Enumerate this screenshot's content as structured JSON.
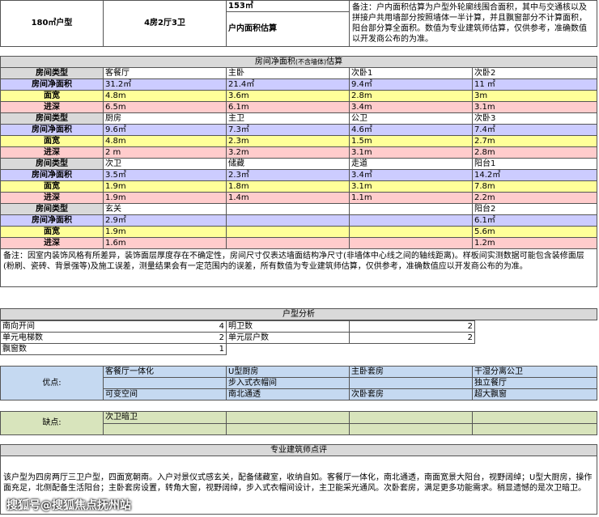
{
  "header": {
    "type": "180㎡户型",
    "layout": "4房2厅3卫",
    "area_value": "153㎡",
    "area_label": "户内面积估算",
    "note": "备注：户内面积估算为户型外轮廓线围合面积，其中与交通核以及拼接户共用墙部分按照墙体一半计算，并且飘窗部分不计算面积，阳台部分算全面积。数值为专业建筑师估算，仅供参考，准确数值以开发商公布的为准。"
  },
  "room_table": {
    "title": "房间净面积",
    "title_small": "(不含墙体)",
    "title_tail": "估算",
    "labels": [
      "房间类型",
      "房间净面积",
      "面宽",
      "进深"
    ],
    "groups": [
      [
        [
          "客餐厅",
          "31.2㎡",
          "4.8m",
          "6.5m"
        ],
        [
          "主卧",
          "21.4㎡",
          "3.6m",
          "6.1m"
        ],
        [
          "次卧1",
          "9.4㎡",
          "2.8m",
          "3.4m"
        ],
        [
          "次卧2",
          "11 ㎡",
          "3m",
          "3.1m"
        ]
      ],
      [
        [
          "厨房",
          "9.6㎡",
          "4.8m",
          "2 m"
        ],
        [
          "主卫",
          "7.3㎡",
          "2.3m",
          "3.2m"
        ],
        [
          "公卫",
          "4.6㎡",
          "1.5m",
          "3.1m"
        ],
        [
          "次卧3",
          "7.4㎡",
          "2.7m",
          "2.8m"
        ]
      ],
      [
        [
          "次卫",
          "3.5㎡",
          "1.9m",
          "1.9m"
        ],
        [
          "储藏",
          "2.3㎡",
          "1.8m",
          "1.4m"
        ],
        [
          "走道",
          "3.4㎡",
          "3.1m",
          "1.1m"
        ],
        [
          "阳台1",
          "14.2㎡",
          "7.8m",
          "2.2m"
        ]
      ],
      [
        [
          "玄关",
          "2.9㎡",
          "1.9m",
          "1.6m"
        ],
        [
          "",
          "",
          "",
          ""
        ],
        [
          "",
          "",
          "",
          ""
        ],
        [
          "阳台2",
          "6.1㎡",
          "5.6m",
          "1.2m"
        ]
      ]
    ],
    "note": "备注：因室内装饰风格有所差异，装饰面层厚度存在不确定性，房间尺寸仅表达墙面结构净尺寸(非墙体中心线之间的轴线距离)。样板间实测数据可能包含装修面层(粉刷、瓷砖、背景强等)及施工误差，测量结果会有一定范围内的误差，所有数值为专业建筑师估算，仅供参考，准确数值应以开发商公布的为准。"
  },
  "analysis": {
    "title": "户型分析",
    "rows": [
      [
        "南向开间",
        "4",
        "明卫数",
        "2"
      ],
      [
        "单元电梯数",
        "2",
        "单元层户数",
        "2"
      ],
      [
        "飘窗数",
        "1",
        "",
        ""
      ]
    ]
  },
  "pros": {
    "label": "优点:",
    "rows": [
      [
        "客餐厅一体化",
        "U型厨房",
        "主卧套房",
        "干湿分离公卫"
      ],
      [
        "",
        "步入式衣帽间",
        "",
        "独立餐厅"
      ],
      [
        "可变空间",
        "南北通透",
        "次卧套房",
        "超大飘窗"
      ]
    ]
  },
  "cons": {
    "label": "缺点:",
    "rows": [
      [
        "次卫暗卫",
        "",
        "",
        ""
      ],
      [
        "",
        "",
        "",
        ""
      ]
    ]
  },
  "review": {
    "title": "专业建筑师点评",
    "text": "该户型为四房两厅三卫户型，四面宽朝南。入户对景仪式感玄关，配备储藏室，收纳自如。客餐厅一体化，南北通透，南面宽景大阳台，视野阔绰；U型大厨房，操作面充足，北侧配备生活阳台；主卧套房设置，转角大窗，视野阔绰，步入式衣帽间设计，主卫能采光通风。次卧套房，满足更多功能需求。稍显遗憾的是次卫暗卫。"
  },
  "watermark": "搜狐号@搜狐焦点抚州站"
}
